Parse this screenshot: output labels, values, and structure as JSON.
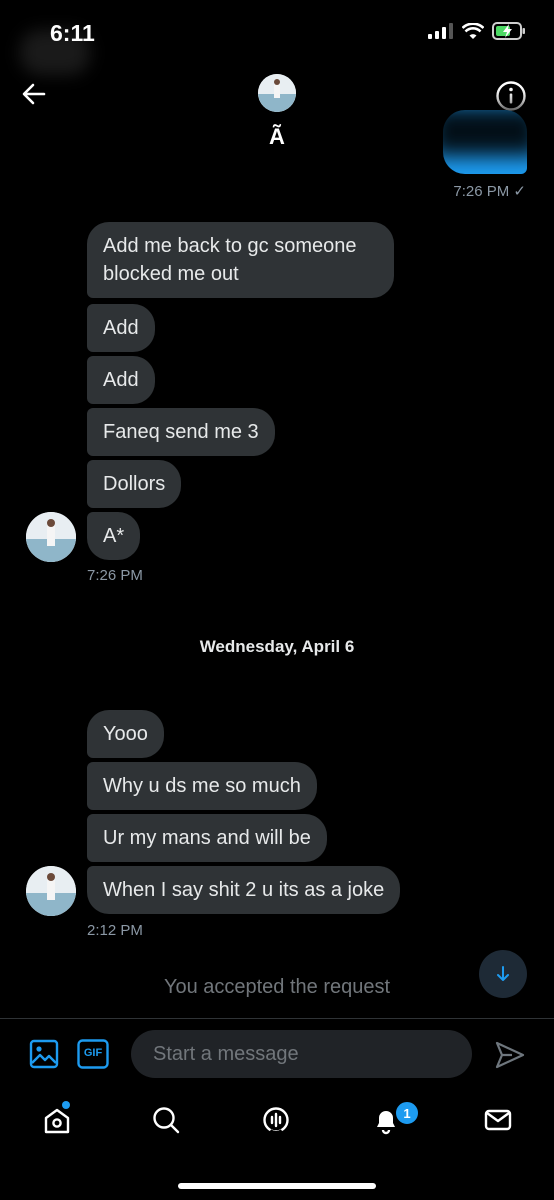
{
  "status_bar": {
    "time": "6:11"
  },
  "header": {
    "name": "Ã"
  },
  "sent": {
    "time": "7:26 PM",
    "receipt": "✓"
  },
  "group1": {
    "messages": [
      "Add me back to gc someone blocked me out",
      "Add",
      "Add",
      "Faneq send me 3",
      "Dollors",
      "A*"
    ],
    "time": "7:26 PM"
  },
  "date_separator": "Wednesday, April 6",
  "group2": {
    "messages": [
      "Yooo",
      "Why u ds me so much",
      "Ur my mans and will be",
      "When I say shit 2 u its as a joke"
    ],
    "time": "2:12 PM"
  },
  "system_notice": "You accepted the request",
  "composer": {
    "placeholder": "Start a message",
    "gif_label": "GIF"
  },
  "tabs": {
    "notifications_count": "1"
  },
  "colors": {
    "accent": "#1d9bf0",
    "bubble": "#2f3336",
    "background": "#000000"
  }
}
